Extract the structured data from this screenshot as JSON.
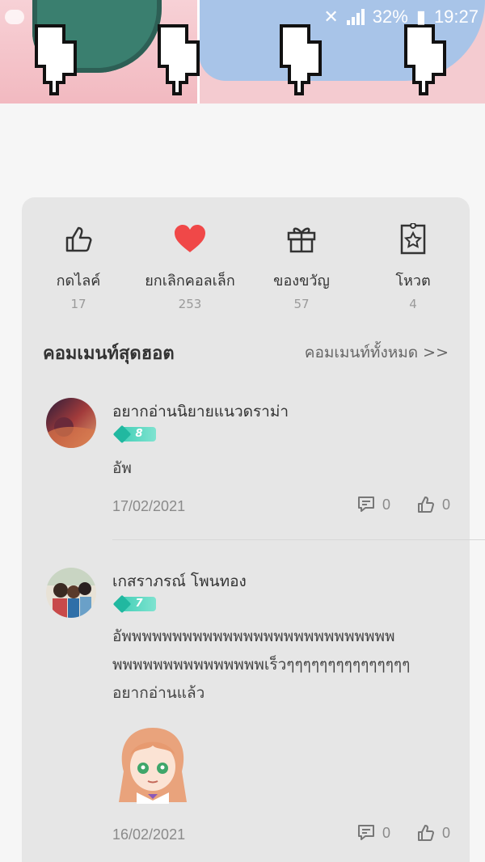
{
  "statusbar": {
    "battery": "32%",
    "time": "19:27"
  },
  "banner": {
    "icons": [
      "pointing-hand-icon",
      "pointing-hand-icon",
      "pointing-hand-icon",
      "pointing-hand-icon"
    ]
  },
  "actions": [
    {
      "icon": "thumbs-up-icon",
      "label": "กดไลค์",
      "count": "17"
    },
    {
      "icon": "heart-icon",
      "label": "ยกเลิกคอลเล็ก",
      "count": "253",
      "color": "#f04848"
    },
    {
      "icon": "gift-icon",
      "label": "ของขวัญ",
      "count": "57"
    },
    {
      "icon": "vote-ticket-icon",
      "label": "โหวต",
      "count": "4"
    }
  ],
  "hot_comments": {
    "title": "คอมเมนท์สุดฮอต",
    "view_all": "คอมเมนท์ทั้งหมด >>"
  },
  "comments": [
    {
      "name": "อยากอ่านนิยายแนวดราม่า",
      "level": "8",
      "text": "อัพ",
      "date": "17/02/2021",
      "replies": "0",
      "likes": "0"
    },
    {
      "name": "เกสราภรณ์ โพนทอง",
      "level": "7",
      "text": "อัพพพพพพพพพพพพพพพพพพพพพพพพพพพพพพพพพพพพพพพพพเร็วๆๆๆๆๆๆๆๆๆๆๆๆๆๆๆ อยากอ่านแล้ว",
      "line1": "อัพพพพพพพพพพพพพพพพพพพพพพพพพพพ",
      "line2": "พพพพพพพพพพพพพพพเร็วๆๆๆๆๆๆๆๆๆๆๆๆๆๆๆ",
      "line3": "อยากอ่านแล้ว",
      "has_sticker": true,
      "date": "16/02/2021",
      "replies": "0",
      "likes": "0"
    }
  ]
}
